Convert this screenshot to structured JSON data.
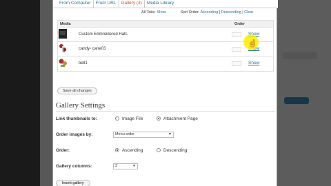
{
  "tabs": [
    {
      "label": "From Computer",
      "active": false
    },
    {
      "label": "From URL",
      "active": false
    },
    {
      "label": "Gallery (3)",
      "active": true
    },
    {
      "label": "Media Library",
      "active": false
    }
  ],
  "filters": {
    "all_tabs_label": "All Tabs:",
    "show": "Show",
    "sort_order_label": "Sort Order:",
    "ascending": "Ascending",
    "sep1": "|",
    "descending": "Descending",
    "sep2": "|",
    "clear": "Clear"
  },
  "media_table": {
    "col_media": "Media",
    "col_order": "Order",
    "rows": [
      {
        "title": "Custom Embroidered Hats",
        "show": "Show"
      },
      {
        "title": "candy- cane03",
        "show": "Show"
      },
      {
        "title": "bell1",
        "show": "Show"
      }
    ]
  },
  "save_button": "Save all changes",
  "gallery_settings": {
    "title": "Gallery Settings",
    "link_label": "Link thumbnails to:",
    "link_options": [
      "Image File",
      "Attachment Page"
    ],
    "link_selected": "Attachment Page",
    "order_by_label": "Order images by:",
    "order_by_value": "Menu order",
    "order_label": "Order:",
    "order_options": [
      "Ascending",
      "Descending"
    ],
    "order_selected": "Ascending",
    "columns_label": "Gallery columns:",
    "columns_value": "3",
    "insert_button": "Insert gallery"
  },
  "icons": {
    "select_arrow": "chevron-down-icon",
    "cursor": "hand-pointer-icon"
  },
  "colors": {
    "link": "#21759b",
    "active_tab": "#d54e21",
    "highlight": "#ffec00"
  }
}
